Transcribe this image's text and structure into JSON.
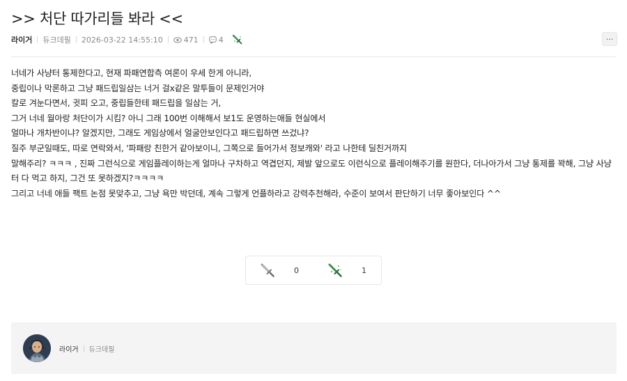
{
  "post": {
    "title": ">> 처단 따가리들 봐라 <<",
    "author": "라이거",
    "server": "듀크데필",
    "datetime": "2026-03-22 14:55:10",
    "views": "471",
    "comments": "4",
    "award_icon": "sword-award-icon",
    "more_label": "···"
  },
  "body": [
    "너네가 사냥터 통제한다고, 현재 파패연합측 여론이 우세 한게 아니라,",
    "중립이나 막론하고 그냥 패드립일삼는 너거 걸x같은 말투들이 문제인거야",
    "칼로 겨눈다면서, 귓피 오고, 중립들한테 패드립을 일삼는 거,",
    "그거 너네 월아랑 처단이가 시킴? 아니 그래 100번 이해해서 보1도 운영하는애들 현실에서",
    "얼마나 개차반이냐? 알겠지만, 그래도 게임상에서 얼굴안보인다고 패드립하면 쓰겄냐?",
    "질주 부군일때도, 따로 연락와서,  '파패랑 친한거 같아보이니, 그쪽으로 들어가서 정보캐와' 라고 나한테 딜친거까지",
    "말해주리? ㅋㅋㅋ , 진짜 그런식으로 게임플레이하는게 얼마나 구차하고 역겹던지, 제발 앞으로도 이런식으로 플레이해주기를 원한다, 더나아가서 그냥 통제를 꽉해, 그냥 사냥터 다 먹고 하지, 그건 또 못하겠지?ㅋㅋㅋㅋ",
    "그리고 너네 애들 팩트 논점 못맞추고, 그냥 욕만 박던데, 계속 그렇게 언플하라고 강력추천해라, 수준이 보여서 판단하기 너무 좋아보인다 ^^"
  ],
  "votes": {
    "down_count": "0",
    "up_count": "1"
  },
  "author_card": {
    "name": "라이거",
    "server": "듀크데필"
  },
  "colors": {
    "award_green": "#3d8f4e",
    "muted": "#8a8a8a",
    "panel": "#f4f4f4"
  }
}
